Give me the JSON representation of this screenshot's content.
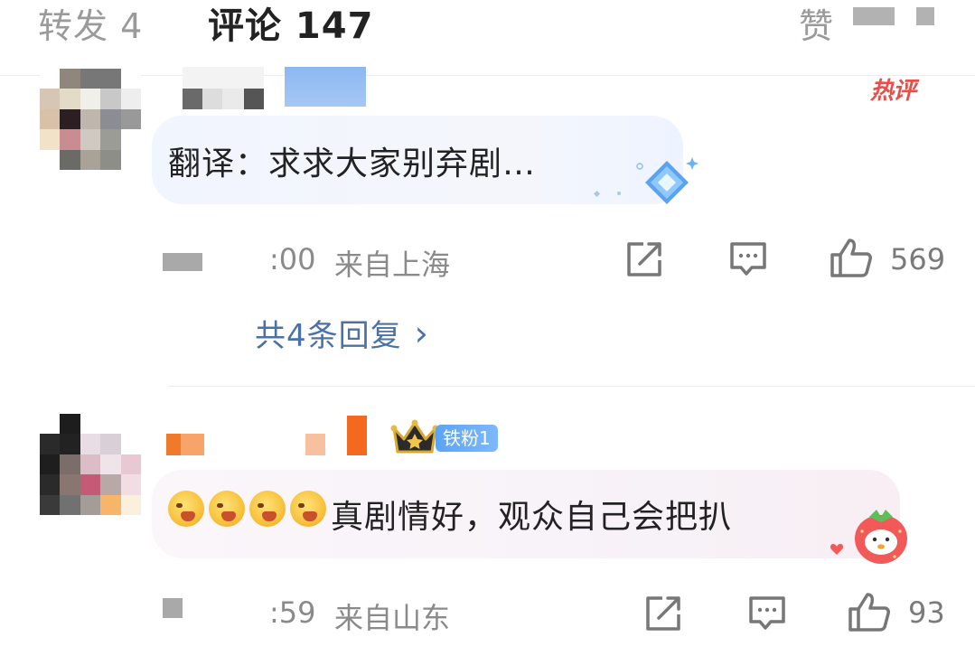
{
  "tabs": {
    "repost": "转发 4",
    "comments": "评论 147",
    "like": "赞"
  },
  "comments": [
    {
      "hot_badge": "热评",
      "text": "翻译：求求大家别弃剧…",
      "time": ":00",
      "location": "来自上海",
      "like_count": "569",
      "replies_link": "共4条回复",
      "replies_chevron": "›"
    },
    {
      "fan_badge": "铁粉1",
      "text": "真剧情好，观众自己会把扒",
      "time": ":59",
      "location": "来自山东",
      "like_count": "93"
    }
  ],
  "icons": [
    "share-icon",
    "comment-icon",
    "thumbs-up-icon",
    "chevron-right-icon",
    "crown-icon",
    "diamond-sticker-icon",
    "strawberry-sticker-icon",
    "heart-icon",
    "laughing-face-emoji"
  ],
  "colors": {
    "link_blue": "#4a72a8",
    "hot_red": "#e6504a",
    "fan_badge_blue": "#5aa4f5",
    "tab_active": "#222222",
    "tab_inactive": "#9a9a9a"
  }
}
